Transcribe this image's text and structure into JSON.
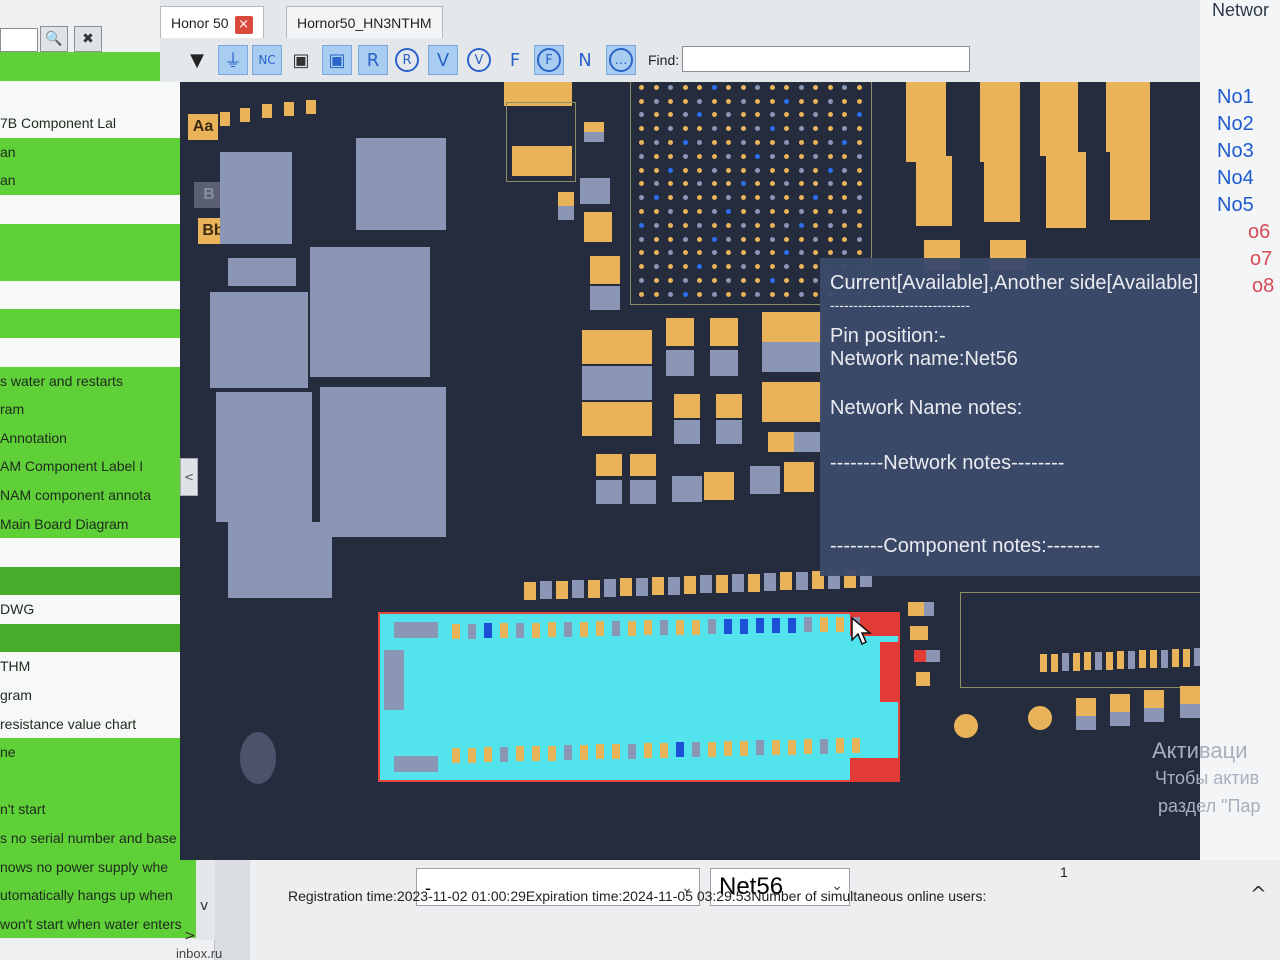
{
  "left_panel": {
    "items": [
      "",
      "",
      "7B Component Lal",
      "an",
      "an",
      "",
      "",
      "",
      "",
      "",
      "",
      "s water and restarts",
      "ram",
      "Annotation",
      "AM Component Label I",
      "NAM component annota",
      "Main Board Diagram",
      "",
      "",
      "DWG",
      "",
      "THM",
      "gram",
      "resistance value chart",
      "ne",
      "",
      "n't start",
      "s no serial number and base",
      "nows no power supply whe",
      "utomatically hangs up when",
      "won't start when water enters"
    ],
    "bottom_text": "inbox.ru"
  },
  "tabs": [
    {
      "label": "Honor 50",
      "close": "×"
    },
    {
      "label": "Hornor50_HN3NTHM"
    }
  ],
  "toolbar": {
    "buttons": [
      "▼",
      "⏚",
      "NC",
      "▣",
      "▣",
      "R",
      "R",
      "V",
      "V",
      "F",
      "F",
      "N",
      "…"
    ],
    "find_label": "Find:",
    "find_value": ""
  },
  "board": {
    "labels": [
      "Aa",
      "B",
      "Bb"
    ]
  },
  "tooltip": {
    "line1": "Current[Available],Another side[Available]",
    "separator": "------------------------------",
    "pin_position": "Pin position:-",
    "network_name": "Network name:Net56",
    "name_notes": "Network Name notes:",
    "network_notes": "--------Network notes--------",
    "component_notes": "--------Component notes:--------"
  },
  "right_panel": {
    "title": "Networ",
    "items": [
      "No1",
      "No2",
      "No3",
      "No4",
      "No5",
      "o6",
      "o7",
      "o8"
    ],
    "watermark_1": "Активаци",
    "watermark_2": "Чтобы актив",
    "watermark_3": "раздел \"Пар"
  },
  "bottom": {
    "pin_select_value": "-",
    "net_select_value": "Net56",
    "status_line": "Registration time:2023-11-02 01:00:29Expiration time:2024-11-05 03:29:53Number of simultaneous online users:",
    "online_users": "1",
    "caret": "^"
  },
  "colors": {
    "board_bg": "#252c3e",
    "pad_gold": "#e9b35a",
    "pad_grey": "#8b96b6",
    "highlight_cyan": "#52e3ec",
    "highlight_red": "#e14a3a",
    "list_green": "#5fd038",
    "tooltip_bg": "#3c4a6a",
    "net_blue": "#1f5bd0"
  }
}
